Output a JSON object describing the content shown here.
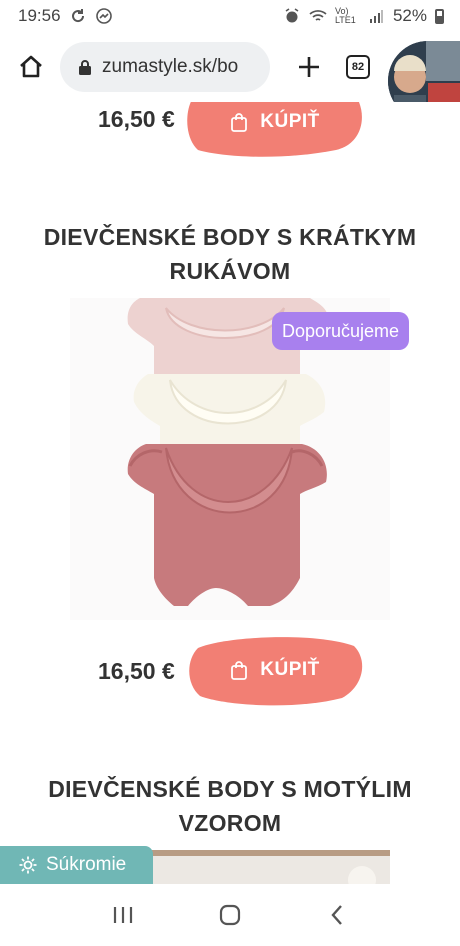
{
  "status_bar": {
    "time": "19:56",
    "network": "Vo) LTE1",
    "battery": "52%"
  },
  "browser": {
    "url": "zumastyle.sk/bo",
    "tab_count": "82"
  },
  "products": [
    {
      "price": "16,50 €",
      "buy_label": "KÚPIŤ"
    },
    {
      "title_line1": "DIEVČENSKÉ BODY S KRÁTKYM",
      "title_line2": "RUKÁVOM",
      "badge": "Doporučujeme",
      "price": "16,50 €",
      "buy_label": "KÚPIŤ"
    },
    {
      "title_line1": "DIEVČENSKÉ BODY S MOTÝLIM",
      "title_line2": "VZOROM"
    }
  ],
  "privacy": {
    "label": "Súkromie"
  },
  "colors": {
    "buy_button": "#f27f74",
    "badge": "#a880ee",
    "privacy_button": "#70b7b5"
  },
  "icons": [
    "sync-icon",
    "messenger-icon",
    "alarm-icon",
    "wifi-icon",
    "signal-icon",
    "battery-icon",
    "home-icon",
    "lock-icon",
    "plus-icon",
    "shopping-bag-icon",
    "gear-icon",
    "recent-apps-icon",
    "home-circle-icon",
    "back-icon"
  ]
}
